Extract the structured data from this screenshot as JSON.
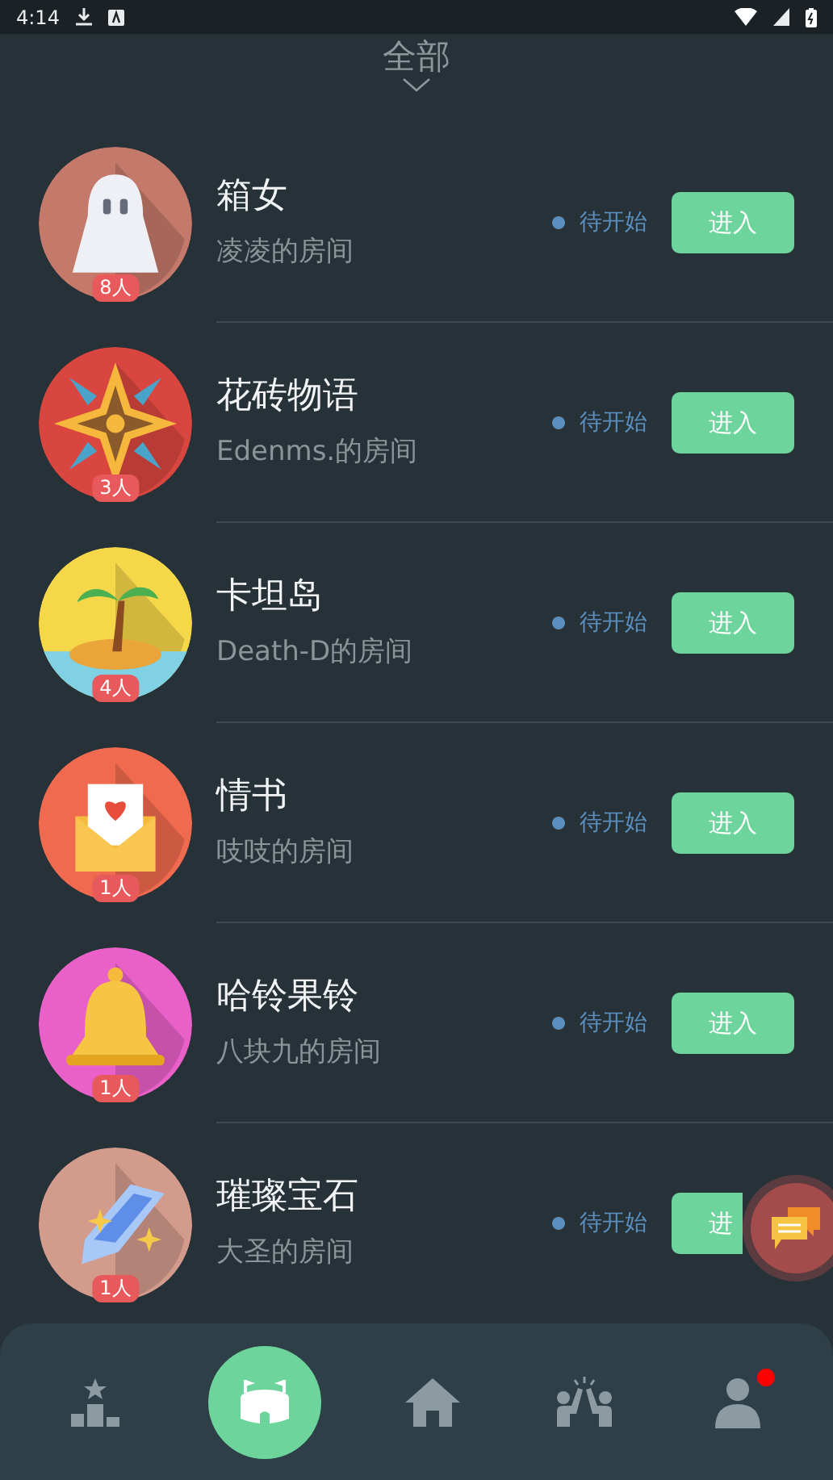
{
  "status_bar": {
    "time": "4:14"
  },
  "header": {
    "title": "全部"
  },
  "rooms": [
    {
      "kind": "ghost",
      "color": "#c4796a",
      "name": "箱女",
      "owner": "凌凌的房间",
      "players": "8人",
      "status": "待开始",
      "button": "进入"
    },
    {
      "kind": "tile",
      "color": "#d9463f",
      "name": "花砖物语",
      "owner": "Edenms.的房间",
      "players": "3人",
      "status": "待开始",
      "button": "进入"
    },
    {
      "kind": "island",
      "color": "#f7d74a",
      "name": "卡坦岛",
      "owner": "Death-D的房间",
      "players": "4人",
      "status": "待开始",
      "button": "进入"
    },
    {
      "kind": "letter",
      "color": "#f06a4f",
      "name": "情书",
      "owner": "吱吱的房间",
      "players": "1人",
      "status": "待开始",
      "button": "进入"
    },
    {
      "kind": "bell",
      "color": "#e860c8",
      "name": "哈铃果铃",
      "owner": "八块九的房间",
      "players": "1人",
      "status": "待开始",
      "button": "进入"
    },
    {
      "kind": "gem",
      "color": "#d39b8c",
      "name": "璀璨宝石",
      "owner": "大圣的房间",
      "players": "1人",
      "status": "待开始",
      "button": "进"
    }
  ],
  "nav": [
    {
      "kind": "ranking",
      "selected": false,
      "badge": false
    },
    {
      "kind": "arena",
      "selected": true,
      "badge": false
    },
    {
      "kind": "home",
      "selected": false,
      "badge": false
    },
    {
      "kind": "friends",
      "selected": false,
      "badge": false
    },
    {
      "kind": "profile",
      "selected": false,
      "badge": true
    }
  ]
}
